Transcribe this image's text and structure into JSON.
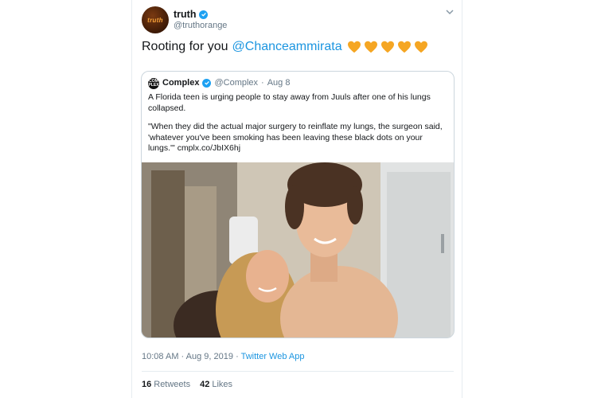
{
  "tweet": {
    "author_name": "truth",
    "author_handle": "@truthorange",
    "avatar_text": "truth",
    "text_prefix": "Rooting for you",
    "mention": "@Chanceammirata",
    "heart_color": "#f5a623",
    "heart_count": 5
  },
  "quoted": {
    "avatar_text": "COM PLEX",
    "name": "Complex",
    "handle": "@Complex",
    "separator": "·",
    "date": "Aug 8",
    "text_line1": "A Florida teen is urging people to stay away from Juuls after one of his lungs collapsed.",
    "text_line2": "\"When they did the actual major surgery to reinflate my lungs, the surgeon said, 'whatever you've been smoking has been leaving these black dots on your lungs.'\"",
    "link": "cmplx.co/JbIX6hj"
  },
  "meta": {
    "time": "10:08 AM",
    "separator": "·",
    "date": "Aug 9, 2019",
    "source": "Twitter Web App"
  },
  "stats": {
    "retweets_count": "16",
    "retweets_label": "Retweets",
    "likes_count": "42",
    "likes_label": "Likes"
  },
  "colors": {
    "link_blue": "#1b95e0",
    "verified_blue": "#1da1f2",
    "muted_gray": "#657786"
  },
  "icons": [
    "verified-icon",
    "chevron-down-icon",
    "orange-heart-icon"
  ]
}
